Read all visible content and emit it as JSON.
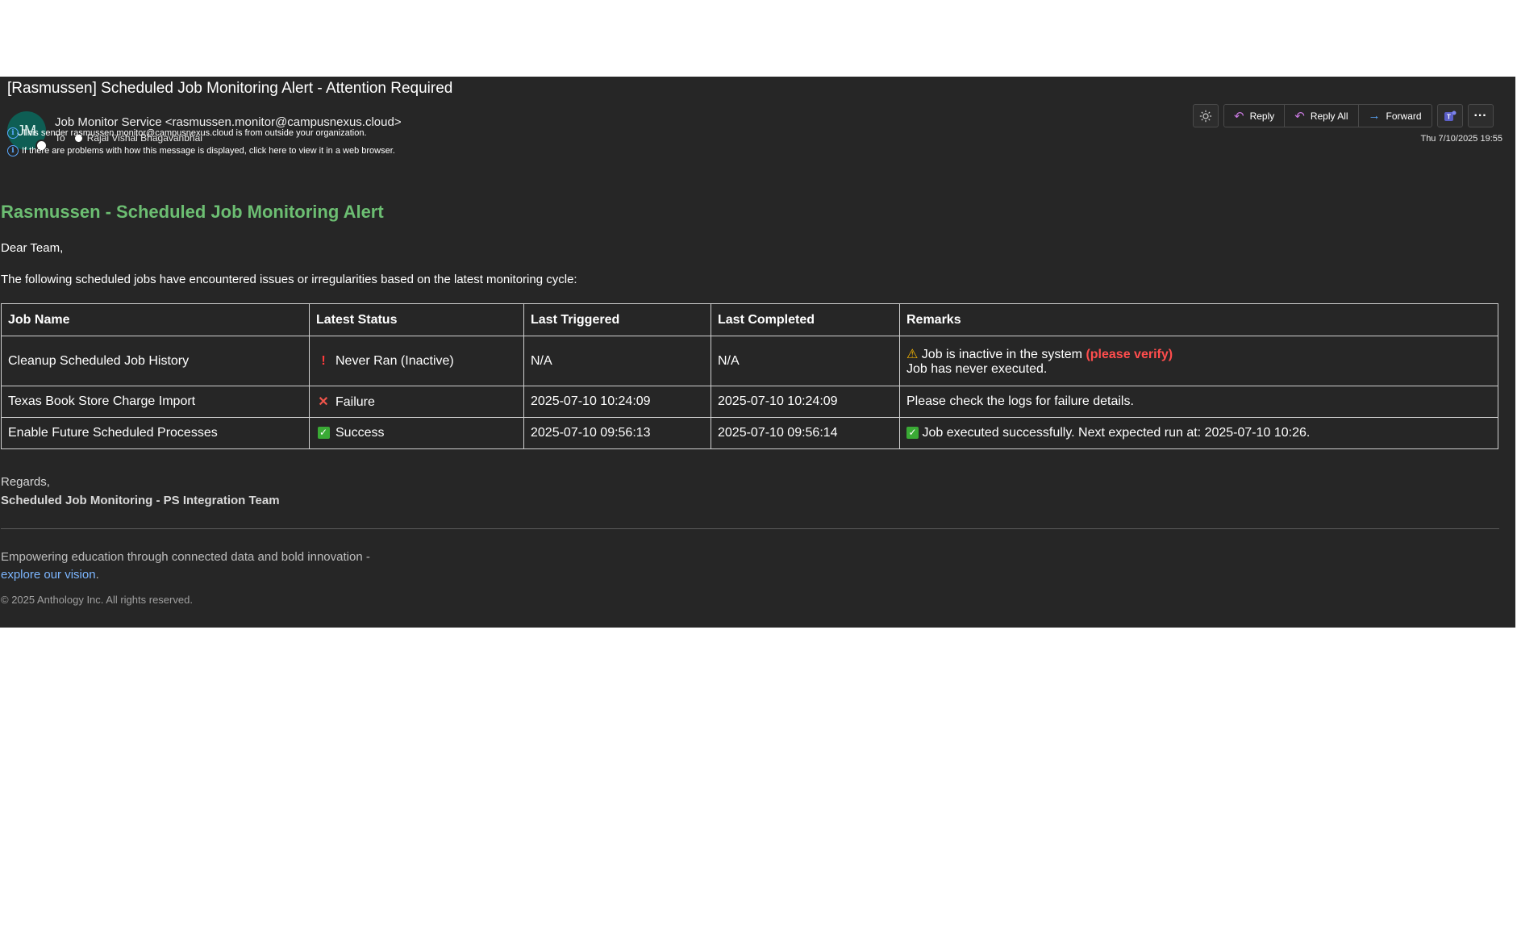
{
  "email": {
    "subject": "[Rasmussen] Scheduled Job Monitoring Alert - Attention Required",
    "avatar_initials": "JM",
    "sender": "Job Monitor Service <rasmussen.monitor@campusnexus.cloud>",
    "to_label": "To",
    "recipient": "Rajai Vishal Bhagavanbhai",
    "notice_external": "This sender rasmussen.monitor@campusnexus.cloud is from outside your organization.",
    "notice_browser": "If there are problems with how this message is displayed, click here to view it in a web browser.",
    "date": "Thu 7/10/2025 19:55"
  },
  "toolbar": {
    "brightness_icon": "sun-icon",
    "reply_label": "Reply",
    "reply_all_label": "Reply All",
    "forward_label": "Forward",
    "teams_icon": "teams-icon",
    "more_label": "···"
  },
  "body": {
    "heading": "Rasmussen - Scheduled Job Monitoring Alert",
    "greeting": "Dear Team,",
    "intro": "The following scheduled jobs have encountered issues or irregularities based on the latest monitoring cycle:",
    "table": {
      "headers": [
        "Job Name",
        "Latest Status",
        "Last Triggered",
        "Last Completed",
        "Remarks"
      ],
      "rows": [
        {
          "job": "Cleanup Scheduled Job History",
          "status_icon": "!",
          "status": "Never Ran (Inactive)",
          "triggered": "N/A",
          "completed": "N/A",
          "remark_icon": "⚠",
          "remark": "Job is inactive in the system",
          "remark_emphasis": "(please verify)",
          "remark_line2": "Job has never executed."
        },
        {
          "job": "Texas Book Store Charge Import",
          "status_icon": "✕",
          "status": "Failure",
          "triggered": "2025-07-10 10:24:09",
          "completed": "2025-07-10 10:24:09",
          "remark": "Please check the logs for failure details."
        },
        {
          "job": "Enable Future Scheduled Processes",
          "status_icon": "✓",
          "status": "Success",
          "triggered": "2025-07-10 09:56:13",
          "completed": "2025-07-10 09:56:14",
          "remark_icon": "✓",
          "remark": "Job executed successfully. Next expected run at: 2025-07-10 10:26."
        }
      ]
    },
    "regards": "Regards,",
    "team": "Scheduled Job Monitoring - PS Integration Team",
    "tagline": "Empowering education through connected data and bold innovation -",
    "link_text": "explore our vision",
    "link_suffix": ".",
    "copyright": "© 2025 Anthology Inc. All rights reserved."
  },
  "colors": {
    "heading_green": "#6cbe72",
    "emphasis_red": "#ff4d4d",
    "link_blue": "#7cb6ff",
    "background": "#262626"
  }
}
